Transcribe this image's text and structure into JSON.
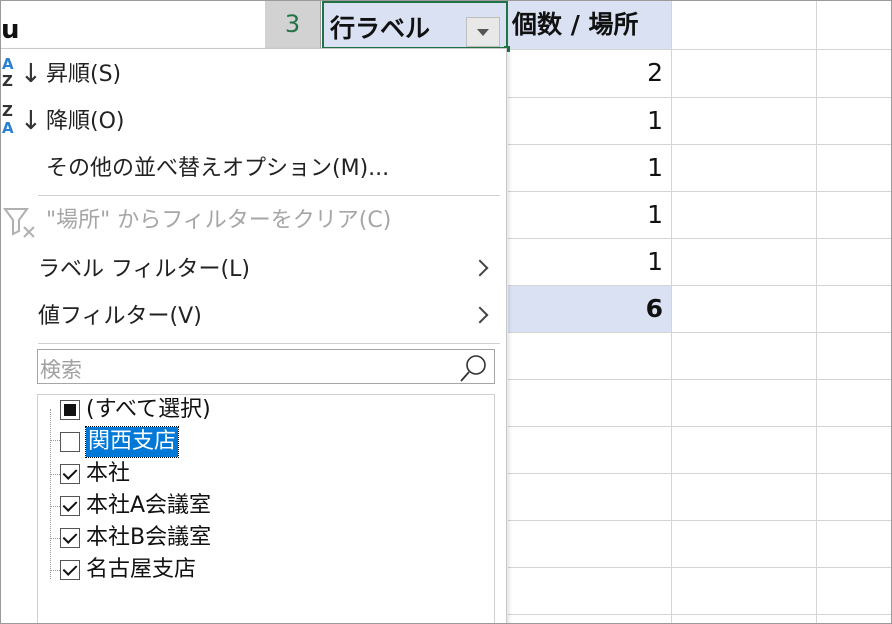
{
  "pivot": {
    "row_number": "3",
    "row_label_header": "行ラベル",
    "value_header": "個数 / 場所",
    "values": [
      "2",
      "1",
      "1",
      "1",
      "1"
    ],
    "total": "6"
  },
  "menu": {
    "sort_asc": "昇順(S)",
    "sort_desc": "降順(O)",
    "more_sort": "その他の並べ替えオプション(M)...",
    "clear_filter": "\"場所\" からフィルターをクリア(C)",
    "label_filter": "ラベル フィルター(L)",
    "value_filter": "値フィルター(V)"
  },
  "search": {
    "placeholder": "検索"
  },
  "filter_items": [
    {
      "label": "(すべて選択)",
      "state": "partial"
    },
    {
      "label": "関西支店",
      "state": "unchecked"
    },
    {
      "label": "本社",
      "state": "checked"
    },
    {
      "label": "本社A会議室",
      "state": "checked"
    },
    {
      "label": "本社B会議室",
      "state": "checked"
    },
    {
      "label": "名古屋支店",
      "state": "checked"
    }
  ],
  "icons": {
    "sort_asc": "sort-a-to-z-icon",
    "sort_desc": "sort-z-to-a-icon",
    "clear_filter": "clear-filter-icon",
    "search": "search-icon",
    "submenu": "chevron-right-icon",
    "dropdown": "dropdown-arrow-icon"
  },
  "colors": {
    "header_fill": "#d9e1f2",
    "selection_border": "#217346",
    "highlight": "#0078d7",
    "sort_letter_blue": "#2b7fd3"
  }
}
